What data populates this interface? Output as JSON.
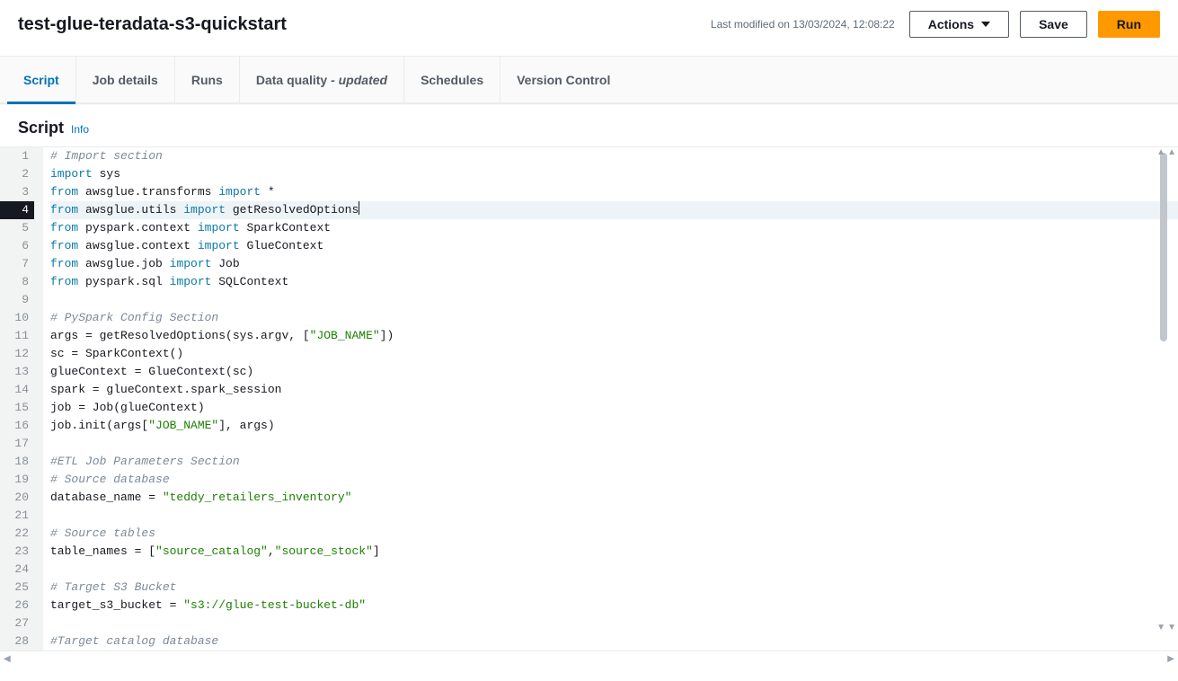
{
  "header": {
    "title": "test-glue-teradata-s3-quickstart",
    "last_modified": "Last modified on 13/03/2024, 12:08:22",
    "actions_label": "Actions",
    "save_label": "Save",
    "run_label": "Run"
  },
  "tabs": {
    "script": "Script",
    "job_details": "Job details",
    "runs": "Runs",
    "data_quality": "Data quality",
    "data_quality_suffix": " - updated",
    "schedules": "Schedules",
    "version_control": "Version Control"
  },
  "section": {
    "title": "Script",
    "info": "Info"
  },
  "code": {
    "highlighted_line": 4,
    "lines": [
      {
        "n": 1,
        "t": "comment",
        "text": "# Import section"
      },
      {
        "n": 2,
        "t": "code",
        "tokens": [
          {
            "kw": "import"
          },
          {
            "tx": " sys"
          }
        ]
      },
      {
        "n": 3,
        "t": "code",
        "tokens": [
          {
            "kw": "from"
          },
          {
            "tx": " awsglue.transforms "
          },
          {
            "kw": "import"
          },
          {
            "tx": " *"
          }
        ]
      },
      {
        "n": 4,
        "t": "code",
        "tokens": [
          {
            "kw": "from"
          },
          {
            "tx": " awsglue.utils "
          },
          {
            "kw": "import"
          },
          {
            "tx": " getResolvedOptions"
          }
        ],
        "cursor_after": true
      },
      {
        "n": 5,
        "t": "code",
        "tokens": [
          {
            "kw": "from"
          },
          {
            "tx": " pyspark.context "
          },
          {
            "kw": "import"
          },
          {
            "tx": " SparkContext"
          }
        ]
      },
      {
        "n": 6,
        "t": "code",
        "tokens": [
          {
            "kw": "from"
          },
          {
            "tx": " awsglue.context "
          },
          {
            "kw": "import"
          },
          {
            "tx": " GlueContext"
          }
        ]
      },
      {
        "n": 7,
        "t": "code",
        "tokens": [
          {
            "kw": "from"
          },
          {
            "tx": " awsglue.job "
          },
          {
            "kw": "import"
          },
          {
            "tx": " Job"
          }
        ]
      },
      {
        "n": 8,
        "t": "code",
        "tokens": [
          {
            "kw": "from"
          },
          {
            "tx": " pyspark.sql "
          },
          {
            "kw": "import"
          },
          {
            "tx": " SQLContext"
          }
        ]
      },
      {
        "n": 9,
        "t": "blank"
      },
      {
        "n": 10,
        "t": "comment",
        "text": "# PySpark Config Section"
      },
      {
        "n": 11,
        "t": "code",
        "tokens": [
          {
            "tx": "args = getResolvedOptions(sys.argv, ["
          },
          {
            "st": "\"JOB_NAME\""
          },
          {
            "tx": "])"
          }
        ]
      },
      {
        "n": 12,
        "t": "code",
        "tokens": [
          {
            "tx": "sc = SparkContext()"
          }
        ]
      },
      {
        "n": 13,
        "t": "code",
        "tokens": [
          {
            "tx": "glueContext = GlueContext(sc)"
          }
        ]
      },
      {
        "n": 14,
        "t": "code",
        "tokens": [
          {
            "tx": "spark = glueContext.spark_session"
          }
        ]
      },
      {
        "n": 15,
        "t": "code",
        "tokens": [
          {
            "tx": "job = Job(glueContext)"
          }
        ]
      },
      {
        "n": 16,
        "t": "code",
        "tokens": [
          {
            "tx": "job.init(args["
          },
          {
            "st": "\"JOB_NAME\""
          },
          {
            "tx": "], args)"
          }
        ]
      },
      {
        "n": 17,
        "t": "blank"
      },
      {
        "n": 18,
        "t": "comment",
        "text": "#ETL Job Parameters Section"
      },
      {
        "n": 19,
        "t": "comment",
        "text": "# Source database"
      },
      {
        "n": 20,
        "t": "code",
        "tokens": [
          {
            "tx": "database_name = "
          },
          {
            "st": "\"teddy_retailers_inventory\""
          }
        ]
      },
      {
        "n": 21,
        "t": "blank"
      },
      {
        "n": 22,
        "t": "comment",
        "text": "# Source tables"
      },
      {
        "n": 23,
        "t": "code",
        "tokens": [
          {
            "tx": "table_names = ["
          },
          {
            "st": "\"source_catalog\""
          },
          {
            "tx": ","
          },
          {
            "st": "\"source_stock\""
          },
          {
            "tx": "]"
          }
        ]
      },
      {
        "n": 24,
        "t": "blank"
      },
      {
        "n": 25,
        "t": "comment",
        "text": "# Target S3 Bucket"
      },
      {
        "n": 26,
        "t": "code",
        "tokens": [
          {
            "tx": "target_s3_bucket = "
          },
          {
            "st": "\"s3://glue-test-bucket-db\""
          }
        ]
      },
      {
        "n": 27,
        "t": "blank"
      },
      {
        "n": 28,
        "t": "comment",
        "text": "#Target catalog database"
      }
    ]
  }
}
